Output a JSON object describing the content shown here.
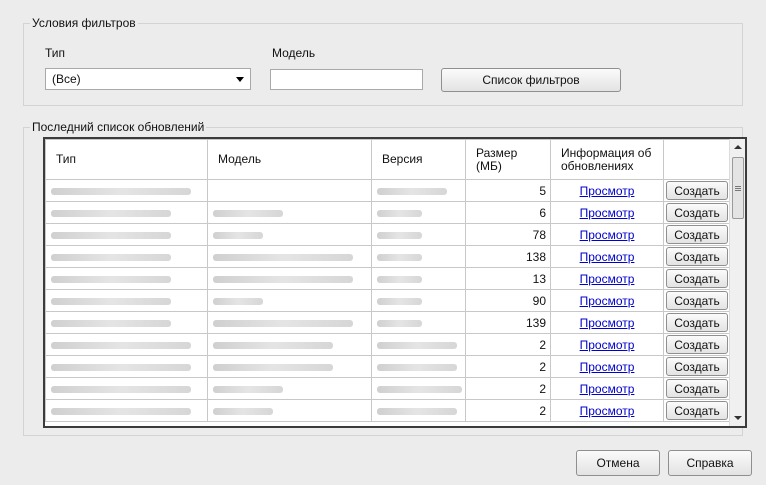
{
  "filters": {
    "legend": "Условия фильтров",
    "type_label": "Тип",
    "type_value": "(Все)",
    "model_label": "Модель",
    "model_value": "",
    "filter_list_button": "Список фильтров"
  },
  "updates": {
    "legend": "Последний список обновлений",
    "columns": {
      "type": "Тип",
      "model": "Модель",
      "version": "Версия",
      "size": "Размер (МБ)",
      "info": "Информация об обновлениях",
      "action": ""
    },
    "view_link": "Просмотр",
    "create_button": "Создать",
    "rows": [
      {
        "size": "5"
      },
      {
        "size": "6"
      },
      {
        "size": "78"
      },
      {
        "size": "138"
      },
      {
        "size": "13"
      },
      {
        "size": "90"
      },
      {
        "size": "139"
      },
      {
        "size": "2"
      },
      {
        "size": "2"
      },
      {
        "size": "2"
      },
      {
        "size": "2"
      }
    ]
  },
  "footer": {
    "cancel_button": "Отмена",
    "help_button": "Справка"
  }
}
